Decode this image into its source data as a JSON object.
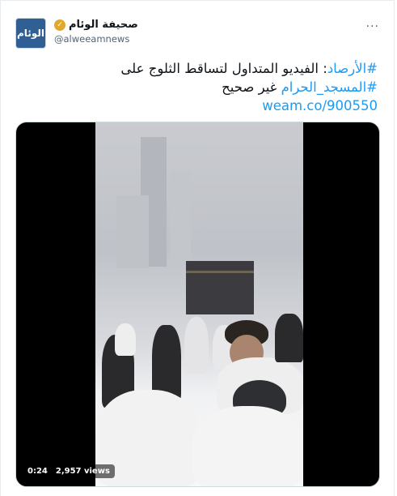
{
  "account": {
    "display_name": "صحيفة الوئام",
    "handle": "@alweeamnews",
    "avatar_text": "الوئام",
    "verified_icon": "verified-badge-icon",
    "verified_color": "#e2a82b"
  },
  "menu": {
    "more_label": "···"
  },
  "tweet": {
    "hashtag1": "#الأرصاد",
    "text1": ": الفيديو المتداول لتساقط الثلوج على",
    "hashtag2": "#المسجد_الحرام",
    "text2": "غير صحيح",
    "link": "weam.co/900550"
  },
  "media": {
    "duration": "0:24",
    "views": "2,957 views"
  },
  "colors": {
    "link": "#1d9bf0",
    "text": "#0f1419",
    "muted": "#536471"
  }
}
